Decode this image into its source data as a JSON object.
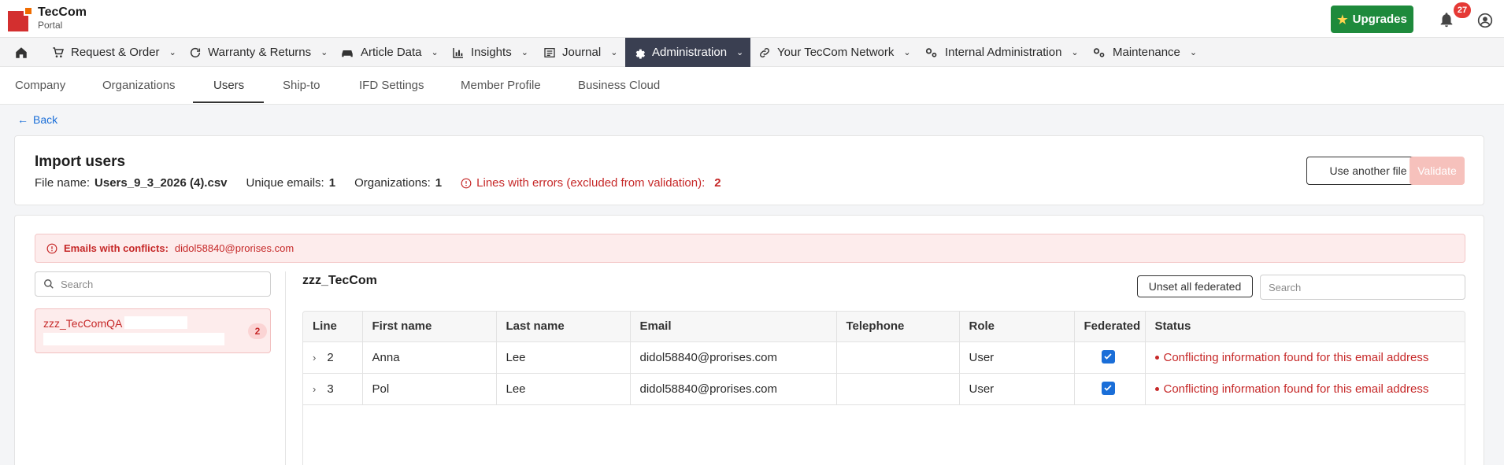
{
  "header": {
    "brand_title": "TecCom",
    "brand_subtitle": "Portal",
    "upgrades_label": "Upgrades",
    "notification_count": "27"
  },
  "main_nav": [
    {
      "label": "Request & Order",
      "icon": "cart-icon"
    },
    {
      "label": "Warranty & Returns",
      "icon": "refresh-icon"
    },
    {
      "label": "Article Data",
      "icon": "car-icon"
    },
    {
      "label": "Insights",
      "icon": "bar-chart-icon"
    },
    {
      "label": "Journal",
      "icon": "list-icon"
    },
    {
      "label": "Administration",
      "icon": "gear-icon",
      "active": true
    },
    {
      "label": "Your TecCom Network",
      "icon": "link-icon"
    },
    {
      "label": "Internal Administration",
      "icon": "gears-icon"
    },
    {
      "label": "Maintenance",
      "icon": "gears-icon"
    }
  ],
  "sub_tabs": [
    {
      "label": "Company"
    },
    {
      "label": "Organizations"
    },
    {
      "label": "Users",
      "active": true
    },
    {
      "label": "Ship-to"
    },
    {
      "label": "IFD Settings"
    },
    {
      "label": "Member Profile"
    },
    {
      "label": "Business Cloud"
    }
  ],
  "back_label": "Back",
  "import": {
    "title": "Import users",
    "file_name_label": "File name:",
    "file_name_value": "Users_9_3_2026 (4).csv",
    "unique_emails_label": "Unique emails:",
    "unique_emails_value": "1",
    "organizations_label": "Organizations:",
    "organizations_value": "1",
    "errors_label": "Lines with errors (excluded from validation):",
    "errors_value": "2",
    "use_another_file_label": "Use another file",
    "validate_label": "Validate"
  },
  "alert": {
    "label": "Emails with conflicts:",
    "value": "didol58840@prorises.com"
  },
  "left_panel": {
    "search_placeholder": "Search",
    "org_name": "zzz_TecComQA",
    "org_count": "2"
  },
  "right_panel": {
    "group_title": "zzz_TecCom",
    "unset_label": "Unset all federated",
    "search_placeholder": "Search"
  },
  "table": {
    "columns": [
      "Line",
      "First name",
      "Last name",
      "Email",
      "Telephone",
      "Role",
      "Federated",
      "Status"
    ],
    "rows": [
      {
        "line": "2",
        "first": "Anna",
        "last": "Lee",
        "email": "didol58840@prorises.com",
        "phone": "",
        "role": "User",
        "federated": true,
        "status": "Conflicting information found for this email address"
      },
      {
        "line": "3",
        "first": "Pol",
        "last": "Lee",
        "email": "didol58840@prorises.com",
        "phone": "",
        "role": "User",
        "federated": true,
        "status": "Conflicting information found for this email address"
      }
    ]
  },
  "colors": {
    "accent_blue": "#1a6ed8",
    "error_red": "#c62828",
    "upgrades_green": "#1e8a3c",
    "nav_active": "#3a3f51"
  }
}
